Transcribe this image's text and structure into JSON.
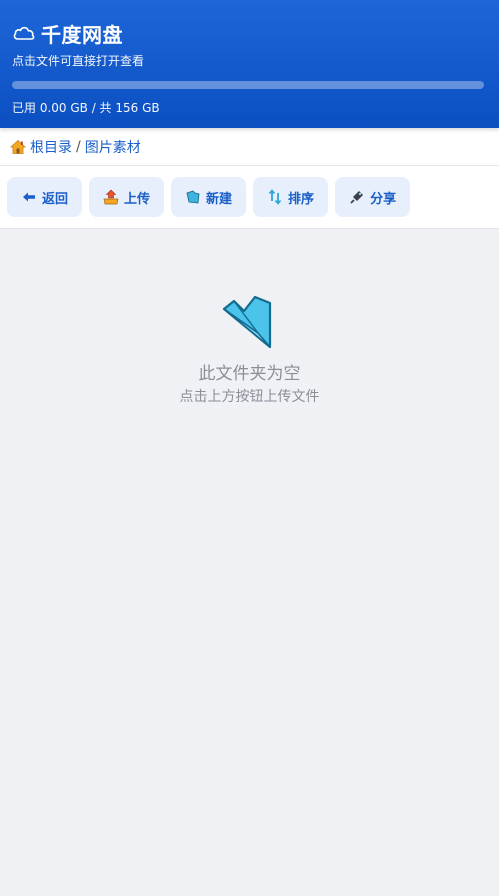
{
  "header": {
    "app_icon": "cloud-icon",
    "title": "千度网盘",
    "subtitle": "点击文件可直接打开查看",
    "storage": {
      "used_fraction": 0.0,
      "usage_text": "已用 0.00 GB / 共 156 GB"
    }
  },
  "breadcrumb": {
    "icon": "home-icon",
    "root": "根目录",
    "separator": "/",
    "current": "图片素材"
  },
  "toolbar": {
    "back_label": "返回",
    "upload_label": "上传",
    "new_label": "新建",
    "sort_label": "排序",
    "share_label": "分享"
  },
  "empty_state": {
    "icon": "open-folder-icon",
    "title": "此文件夹为空",
    "hint": "点击上方按钮上传文件"
  },
  "colors": {
    "header_top": "#1e66d8",
    "header_bottom": "#0b4fc1",
    "accent": "#1a5fc9",
    "button_bg": "#e6effb",
    "page_bg": "#eff1f5",
    "folder": "#4cc3ea"
  }
}
